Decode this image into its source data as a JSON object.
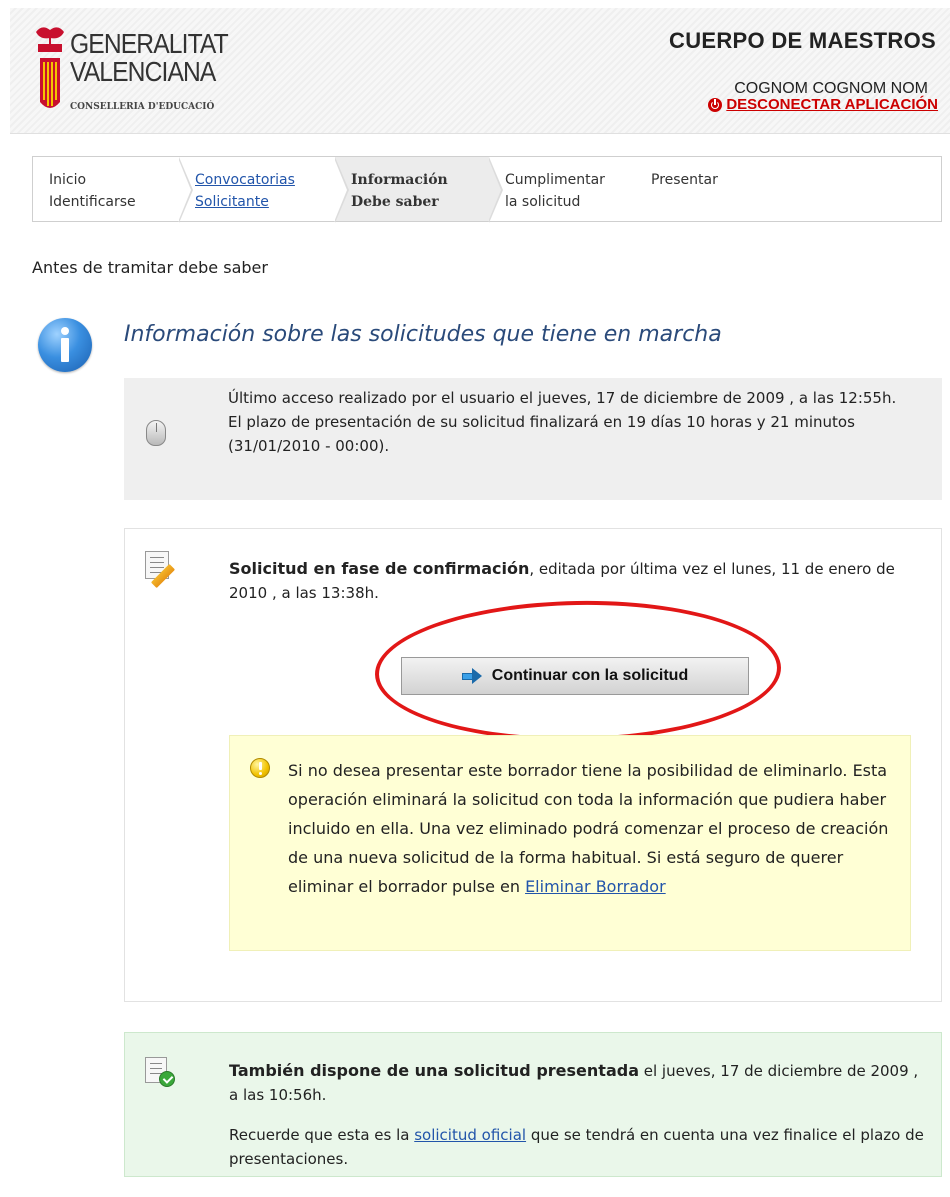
{
  "header": {
    "logo_line1": "GENERALITAT",
    "logo_line2": "VALENCIANA",
    "logo_sub": "CONSELLERIA D'EDUCACIÓ",
    "app_title": "CUERPO DE MAESTROS",
    "user_name": "COGNOM COGNOM NOM",
    "logout_label": "DESCONECTAR APLICACIÓN"
  },
  "steps": [
    {
      "line1": "Inicio",
      "line2": "Identificarse"
    },
    {
      "line1": "Convocatorias",
      "line2": "Solicitante"
    },
    {
      "line1": "Información",
      "line2": "Debe saber"
    },
    {
      "line1": "Cumplimentar",
      "line2": "la solicitud"
    },
    {
      "line1": "Presentar",
      "line2": ""
    }
  ],
  "section_title": "Antes de tramitar debe saber",
  "info_heading": "Información sobre las solicitudes que tiene en marcha",
  "access": {
    "line1": "Último acceso realizado por el usuario el jueves, 17 de diciembre de 2009 , a las 12:55h.",
    "line2": "El plazo de presentación de su solicitud finalizará en 19 días 10 horas y 21 minutos (31/01/2010 - 00:00)."
  },
  "draft": {
    "title": "Solicitud en fase de confirmación",
    "text": ", editada por última vez el lunes, 11 de enero de 2010 , a las 13:38h.",
    "continue_label": "Continuar con la solicitud",
    "warning_text": "Si no desea presentar este borrador tiene la posibilidad de eliminarlo. Esta operación eliminará la solicitud con toda la información que pudiera haber incluido en ella. Una vez eliminado podrá comenzar el proceso de creación de una nueva solicitud de la forma habitual. Si está seguro de querer eliminar el borrador pulse en ",
    "delete_link": "Eliminar Borrador"
  },
  "submitted": {
    "title": "También dispone de una solicitud presentada",
    "text": " el jueves, 17 de diciembre de 2009 , a las 10:56h.",
    "note_before": "Recuerde que esta es la ",
    "note_link": "solicitud oficial",
    "note_after": " que se tendrá en cuenta una vez finalice el plazo de presentaciones."
  },
  "colors": {
    "accent_red": "#e21717",
    "link_blue": "#2255aa",
    "warning_bg": "#ffffd5",
    "success_bg": "#eaf7ea"
  }
}
